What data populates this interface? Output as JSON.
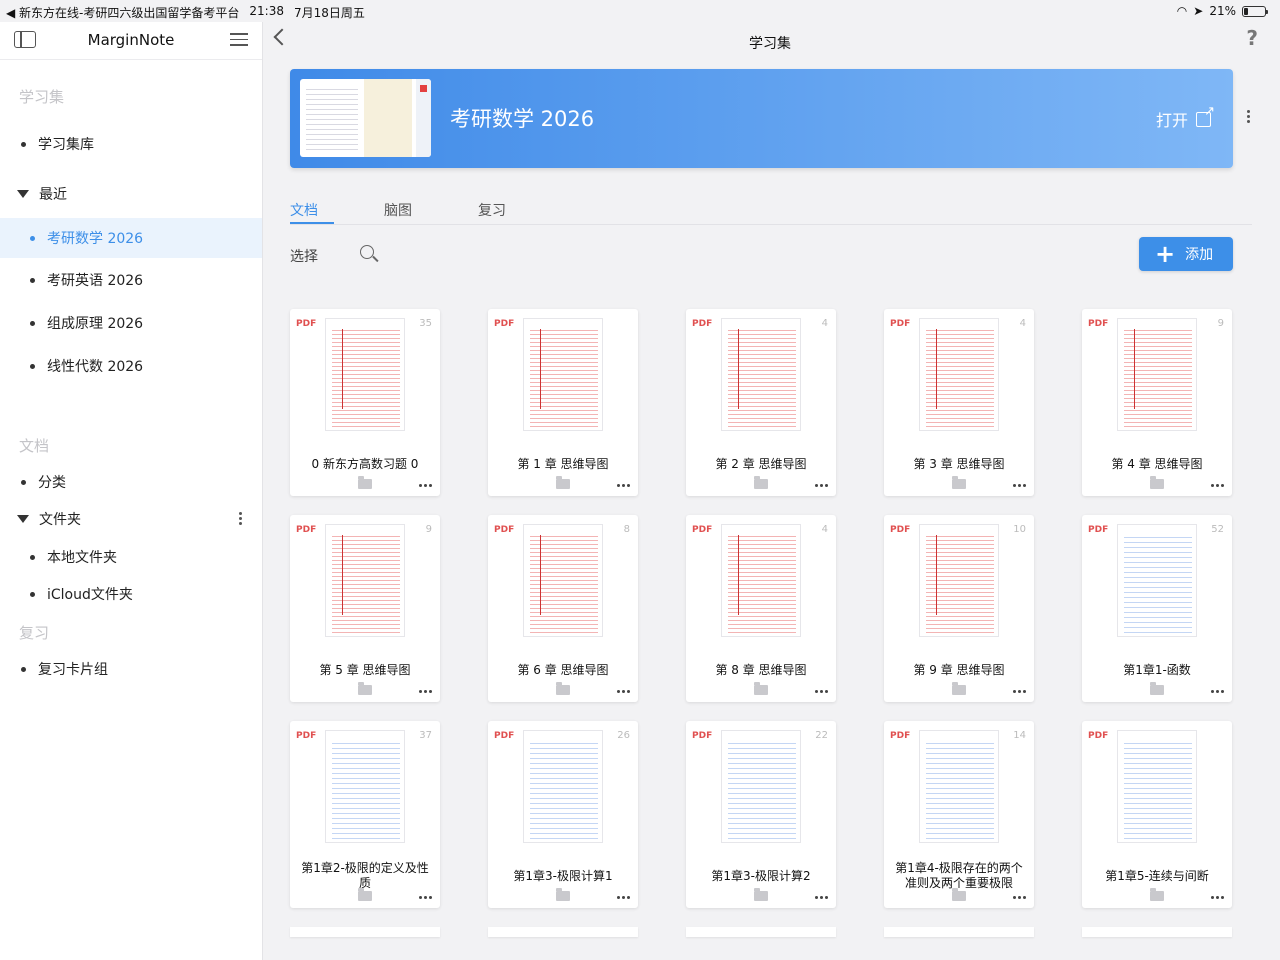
{
  "status_bar": {
    "back_app": "◀ 新东方在线-考研四六级出国留学备考平台",
    "time": "21:38",
    "date": "7月18日周五",
    "battery": "21%",
    "battery_level": 0.21
  },
  "sidebar": {
    "app_title": "MarginNote",
    "section_study": "学习集",
    "library": "学习集库",
    "recent_label": "最近",
    "recent_items": [
      "考研数学 2026",
      "考研英语 2026",
      "组成原理 2026",
      "线性代数 2026"
    ],
    "section_docs": "文档",
    "category": "分类",
    "folders_label": "文件夹",
    "folders": [
      "本地文件夹",
      "iCloud文件夹"
    ],
    "section_review": "复习",
    "review_group": "复习卡片组"
  },
  "header": {
    "title": "学习集",
    "help": "?"
  },
  "banner": {
    "title": "考研数学 2026",
    "open_label": "打开"
  },
  "tabs": [
    "文档",
    "脑图",
    "复习"
  ],
  "toolbar": {
    "select_label": "选择",
    "add_label": "添加"
  },
  "documents": [
    {
      "title": "0 新东方高数习题 0",
      "pages": "35",
      "type": "PDF"
    },
    {
      "title": "第 1 章 思维导图",
      "pages": "",
      "type": "PDF"
    },
    {
      "title": "第 2 章 思维导图",
      "pages": "4",
      "type": "PDF"
    },
    {
      "title": "第 3 章 思维导图",
      "pages": "4",
      "type": "PDF"
    },
    {
      "title": "第 4 章 思维导图",
      "pages": "9",
      "type": "PDF"
    },
    {
      "title": "第 5 章 思维导图",
      "pages": "9",
      "type": "PDF"
    },
    {
      "title": "第 6 章 思维导图",
      "pages": "8",
      "type": "PDF"
    },
    {
      "title": "第 8 章 思维导图",
      "pages": "4",
      "type": "PDF"
    },
    {
      "title": "第 9 章 思维导图",
      "pages": "10",
      "type": "PDF"
    },
    {
      "title": "第1章1-函数",
      "pages": "52",
      "type": "PDF"
    },
    {
      "title": "第1章2-极限的定义及性质",
      "pages": "37",
      "type": "PDF"
    },
    {
      "title": "第1章3-极限计算1",
      "pages": "26",
      "type": "PDF"
    },
    {
      "title": "第1章3-极限计算2",
      "pages": "22",
      "type": "PDF"
    },
    {
      "title": "第1章4-极限存在的两个准则及两个重要极限",
      "pages": "14",
      "type": "PDF"
    },
    {
      "title": "第1章5-连续与间断",
      "pages": "",
      "type": "PDF"
    }
  ],
  "colors": {
    "accent": "#3d8fe8",
    "pdf_label": "#e05050"
  }
}
